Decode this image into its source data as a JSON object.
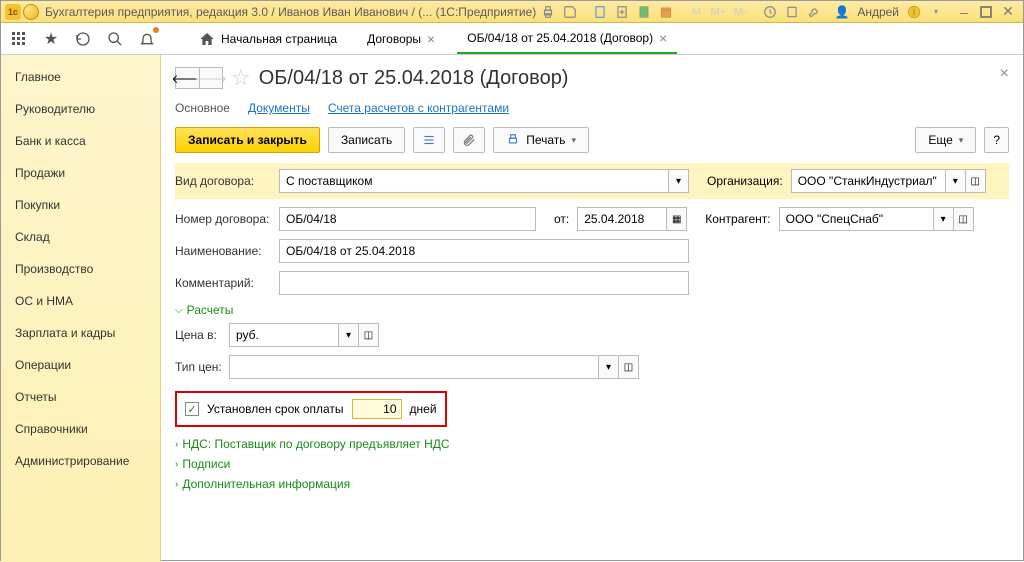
{
  "titlebar": {
    "title": "Бухгалтерия предприятия, редакция 3.0 / Иванов Иван Иванович / (...  (1С:Предприятие)",
    "user": "Андрей",
    "m_labels": [
      "M",
      "M+",
      "M-"
    ]
  },
  "toolbar2": {
    "home": "Начальная страница",
    "tabs": [
      {
        "label": "Договоры",
        "active": false
      },
      {
        "label": "ОБ/04/18 от 25.04.2018 (Договор)",
        "active": true
      }
    ]
  },
  "sidebar": {
    "items": [
      "Главное",
      "Руководителю",
      "Банк и касса",
      "Продажи",
      "Покупки",
      "Склад",
      "Производство",
      "ОС и НМА",
      "Зарплата и кадры",
      "Операции",
      "Отчеты",
      "Справочники",
      "Администрирование"
    ]
  },
  "page": {
    "title": "ОБ/04/18 от 25.04.2018 (Договор)",
    "subtabs": [
      "Основное",
      "Документы",
      "Счета расчетов с контрагентами"
    ],
    "buttons": {
      "save_close": "Записать и закрыть",
      "save": "Записать",
      "print": "Печать",
      "more": "Еще"
    },
    "fields": {
      "contract_type_lbl": "Вид договора:",
      "contract_type_val": "С поставщиком",
      "org_lbl": "Организация:",
      "org_val": "ООО \"СтанкИндустриал\"",
      "num_lbl": "Номер договора:",
      "num_val": "ОБ/04/18",
      "date_lbl": "от:",
      "date_val": "25.04.2018",
      "counter_lbl": "Контрагент:",
      "counter_val": "ООО \"СпецСнаб\"",
      "name_lbl": "Наименование:",
      "name_val": "ОБ/04/18 от 25.04.2018",
      "comment_lbl": "Комментарий:",
      "comment_val": "",
      "calc_exp": "Расчеты",
      "price_lbl": "Цена в:",
      "price_val": "руб.",
      "type_lbl": "Тип цен:",
      "type_val": "",
      "term_chk_lbl": "Установлен срок оплаты",
      "term_val": "10",
      "term_unit": "дней",
      "vat_exp": "НДС: Поставщик по договору предъявляет НДС",
      "sign_exp": "Подписи",
      "addl_exp": "Дополнительная информация"
    }
  }
}
